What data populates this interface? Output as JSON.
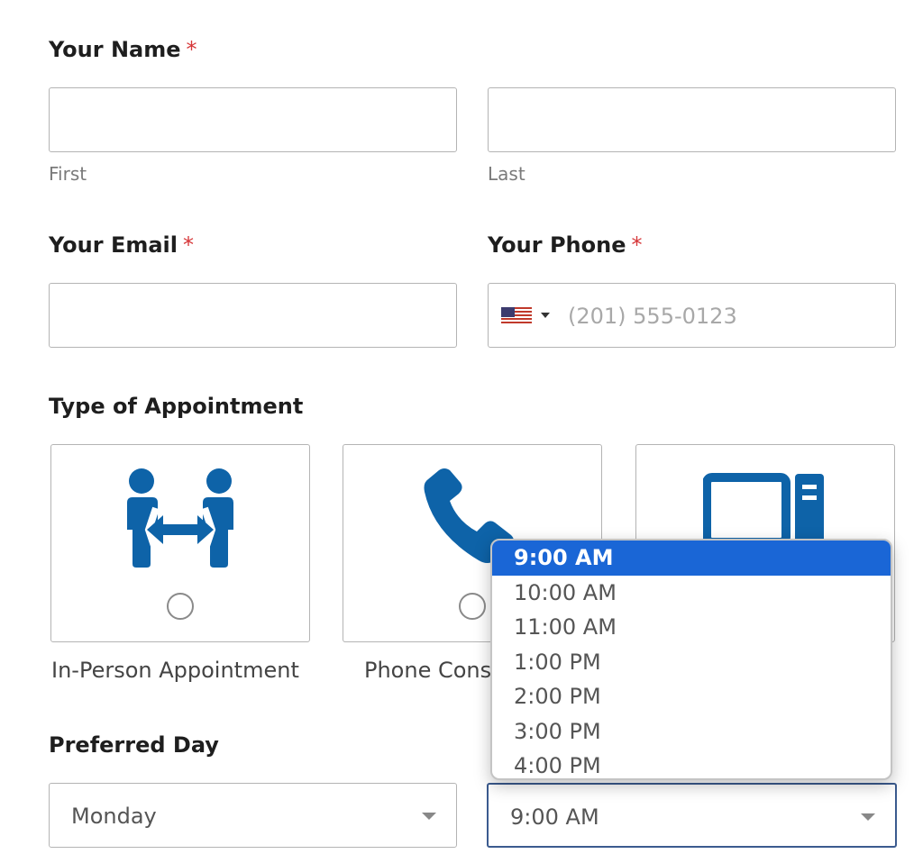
{
  "name": {
    "label": "Your Name",
    "required_mark": "*",
    "first_sublabel": "First",
    "last_sublabel": "Last"
  },
  "email": {
    "label": "Your Email",
    "required_mark": "*"
  },
  "phone": {
    "label": "Your Phone",
    "required_mark": "*",
    "placeholder": "(201) 555-0123",
    "country_flag_icon": "us-flag-icon"
  },
  "appointment": {
    "label": "Type of Appointment",
    "options": [
      {
        "caption": "In-Person Appointment",
        "icon": "people-exchange-icon"
      },
      {
        "caption": "Phone Cons",
        "icon": "phone-icon"
      },
      {
        "caption": "",
        "icon": "computer-icon"
      }
    ]
  },
  "preferred_day": {
    "label": "Preferred Day",
    "value": "Monday"
  },
  "preferred_time": {
    "value": "9:00 AM",
    "options": [
      "9:00 AM",
      "10:00 AM",
      "11:00 AM",
      "1:00 PM",
      "2:00 PM",
      "3:00 PM",
      "4:00 PM"
    ],
    "selected": "9:00 AM"
  },
  "colors": {
    "accent": "#1a66d6",
    "icon_blue": "#0e63a8",
    "required": "#d63638",
    "focus_border": "#3b5b8f"
  }
}
